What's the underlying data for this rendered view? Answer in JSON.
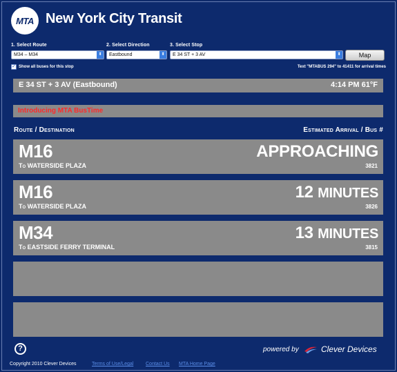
{
  "header": {
    "logo_text": "MTA",
    "title": "New York City Transit"
  },
  "controls": {
    "route_label": "1. Select Route",
    "route_value": "M34 – M34",
    "direction_label": "2. Select Direction",
    "direction_value": "Eastbound",
    "stop_label": "3. Select Stop",
    "stop_value": "E 34 ST + 3 AV",
    "map_button": "Map",
    "show_all_label": "Show all buses for this stop",
    "sms_text": "Text \"MTABUS 294\" to 41411 for arrival times"
  },
  "stop_bar": {
    "name": "E 34 ST + 3 AV (Eastbound)",
    "time_weather": "4:14 PM  61°F"
  },
  "notice": {
    "text": "Introducing MTA BusTime"
  },
  "table": {
    "left_header": "Route / Destination",
    "right_header": "Estimated Arrival / Bus #",
    "rows": [
      {
        "route": "M16",
        "destination": "To WATERSIDE PLAZA",
        "eta": "APPROACHING",
        "eta_unit": "",
        "bus": "3821"
      },
      {
        "route": "M16",
        "destination": "To WATERSIDE PLAZA",
        "eta": "12",
        "eta_unit": "MINUTES",
        "bus": "3826"
      },
      {
        "route": "M34",
        "destination": "To EASTSIDE FERRY TERMINAL",
        "eta": "13",
        "eta_unit": "MINUTES",
        "bus": "3815"
      }
    ]
  },
  "footer": {
    "help": "?",
    "powered_by": "powered by",
    "vendor": "Clever Devices",
    "copyright": "Copyright 2010 Clever Devices",
    "links": [
      "Terms of Use/Legal",
      "Contact Us",
      "MTA Home Page"
    ]
  },
  "colors": {
    "background": "#0d2a6d",
    "panel": "#8a8a8a",
    "notice": "#ff2a2a",
    "link": "#5b8ee8"
  }
}
